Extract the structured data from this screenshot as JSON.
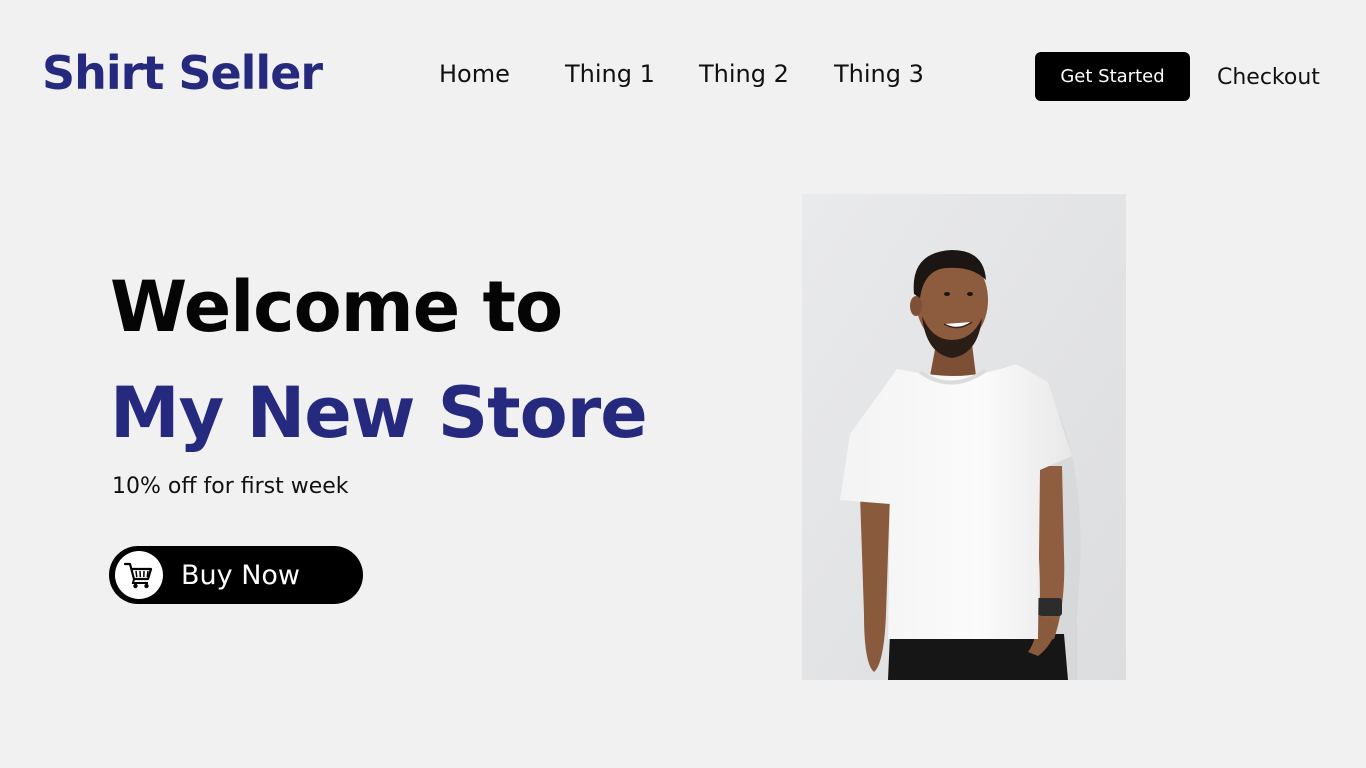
{
  "header": {
    "brand": "Shirt Seller",
    "nav": [
      "Home",
      "Thing 1",
      "Thing 2",
      "Thing 3"
    ],
    "cta_label": "Get Started",
    "checkout_label": "Checkout"
  },
  "hero": {
    "line1": "Welcome to",
    "line2": "My New Store",
    "promo": "10% off for first week",
    "buy_label": "Buy Now",
    "buy_icon": "shopping-cart-icon"
  },
  "colors": {
    "background": "#f1f1f1",
    "brand": "#262a7f",
    "button": "#000000"
  }
}
